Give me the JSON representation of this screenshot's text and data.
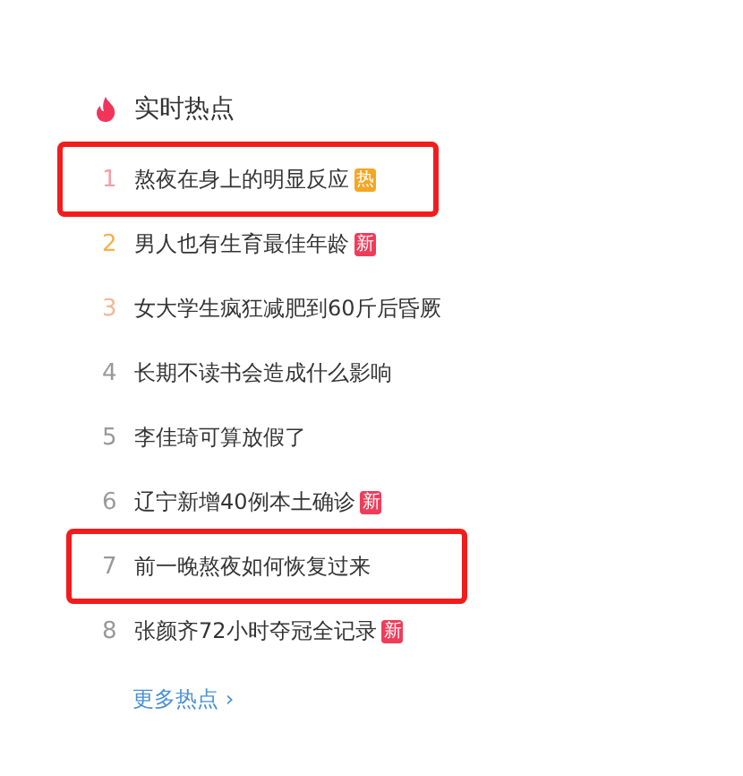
{
  "header": {
    "title": "实时热点"
  },
  "items": [
    {
      "rank": "1",
      "color": "#f4a0a8",
      "text": "熬夜在身上的明显反应",
      "badge": {
        "kind": "hot",
        "text": "热"
      },
      "highlighted": true
    },
    {
      "rank": "2",
      "color": "#f5b04a",
      "text": "男人也有生育最佳年龄",
      "badge": {
        "kind": "new",
        "text": "新"
      },
      "highlighted": false
    },
    {
      "rank": "3",
      "color": "#f0b89a",
      "text": "女大学生疯狂减肥到60斤后昏厥",
      "highlighted": false
    },
    {
      "rank": "4",
      "color": "#999999",
      "text": "长期不读书会造成什么影响",
      "highlighted": false
    },
    {
      "rank": "5",
      "color": "#999999",
      "text": "李佳琦可算放假了",
      "highlighted": false
    },
    {
      "rank": "6",
      "color": "#999999",
      "text": "辽宁新增40例本土确诊",
      "badge": {
        "kind": "new",
        "text": "新"
      },
      "highlighted": false
    },
    {
      "rank": "7",
      "color": "#999999",
      "text": "前一晚熬夜如何恢复过来",
      "highlighted": true
    },
    {
      "rank": "8",
      "color": "#999999",
      "text": "张颜齐72小时夺冠全记录",
      "badge": {
        "kind": "new",
        "text": "新"
      },
      "highlighted": false
    }
  ],
  "more_link": {
    "text": "更多热点",
    "arrow": "›"
  }
}
